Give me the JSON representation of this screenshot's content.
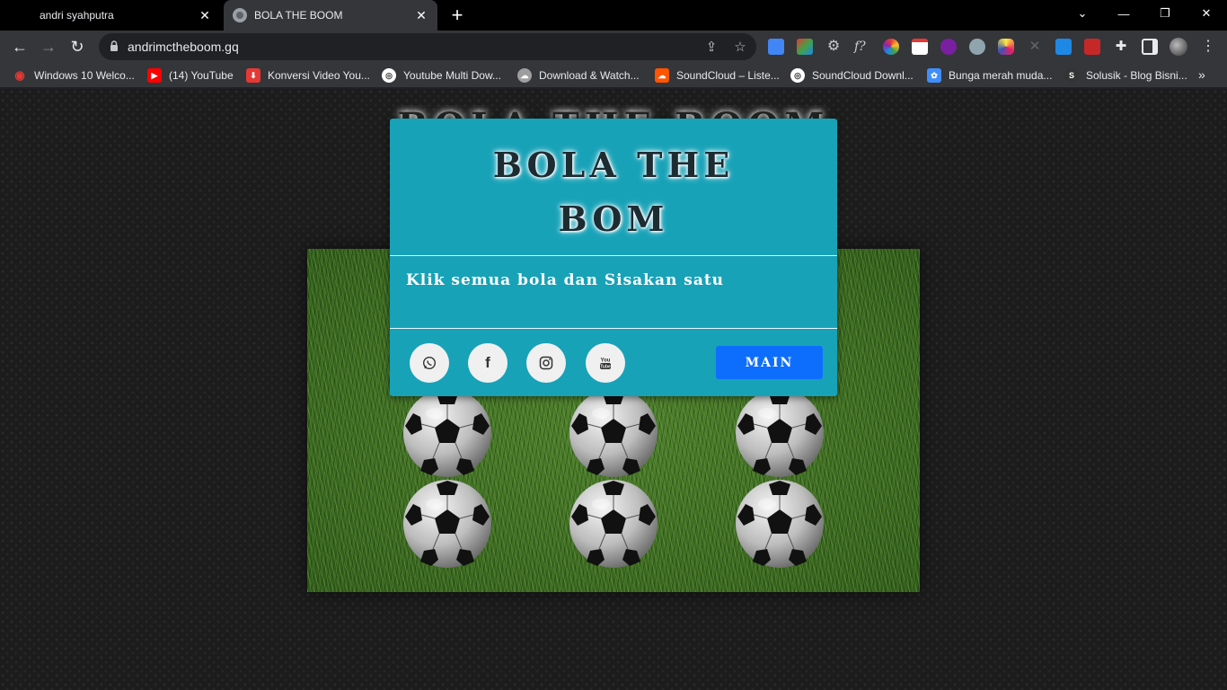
{
  "browser": {
    "tabs": [
      {
        "title": "andri syahputra",
        "active": false
      },
      {
        "title": "BOLA THE BOOM",
        "active": true
      }
    ],
    "new_tab_icon": "plus-icon",
    "url": "andrimctheboom.gq",
    "bookmarks": [
      {
        "label": "Windows 10 Welco...",
        "icon_color": "#e53935"
      },
      {
        "label": "(14) YouTube",
        "icon_color": "#ff0000"
      },
      {
        "label": "Konversi Video You...",
        "icon_color": "#e53935"
      },
      {
        "label": "Youtube Multi Dow...",
        "icon_color": "#ffffff"
      },
      {
        "label": "Download & Watch...",
        "icon_color": "#9e9e9e"
      },
      {
        "label": "SoundCloud – Liste...",
        "icon_color": "#ff5500"
      },
      {
        "label": "SoundCloud Downl...",
        "icon_color": "#ffffff"
      },
      {
        "label": "Bunga merah muda...",
        "icon_color": "#3f8efc"
      },
      {
        "label": "Solusik - Blog Bisni...",
        "icon_color": "#333333"
      }
    ]
  },
  "page": {
    "background_title": "BOLA THE BOOM",
    "modal": {
      "title_line1": "BOLA THE",
      "title_line2": "BOM",
      "instruction": "Klik semua bola dan Sisakan satu",
      "social": [
        "whatsapp-icon",
        "facebook-icon",
        "instagram-icon",
        "youtube-icon"
      ],
      "play_label": "MAIN",
      "color": "#17a2b8",
      "button_color": "#0d6efd"
    },
    "balls_count": 6
  }
}
